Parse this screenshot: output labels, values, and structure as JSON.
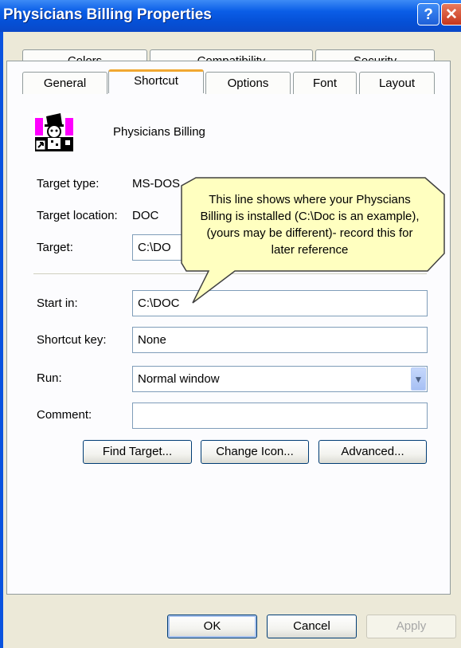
{
  "window": {
    "title": "Physicians Billing Properties",
    "help_glyph": "?",
    "close_glyph": "✕"
  },
  "tabs": {
    "row1": [
      "Colors",
      "Compatibility",
      "Security"
    ],
    "row2": [
      "General",
      "Shortcut",
      "Options",
      "Font",
      "Layout"
    ],
    "active": "Shortcut"
  },
  "app": {
    "name": "Physicians Billing",
    "icon": "ms-dos-clown-icon"
  },
  "fields": {
    "target_type_label": "Target type:",
    "target_type_value": "MS-DOS",
    "target_location_label": "Target location:",
    "target_location_value": "DOC",
    "target_label": "Target:",
    "target_value": "C:\\DO",
    "start_in_label": "Start in:",
    "start_in_value": "C:\\DOC",
    "shortcut_key_label": "Shortcut key:",
    "shortcut_key_value": "None",
    "run_label": "Run:",
    "run_value": "Normal window",
    "comment_label": "Comment:",
    "comment_value": ""
  },
  "buttons": {
    "find_target": "Find Target...",
    "change_icon": "Change Icon...",
    "advanced": "Advanced...",
    "ok": "OK",
    "cancel": "Cancel",
    "apply": "Apply"
  },
  "callout": {
    "lines": [
      "This line shows where your Physcians",
      "Billing is installed (C:\\Doc is an example),",
      "(yours may be different)- record this for",
      "later reference"
    ],
    "fill": "#ffffc0"
  },
  "colors": {
    "titlebar": "#0550d6",
    "dialog_bg": "#ece9d8",
    "active_tab_accent": "#f1a832"
  }
}
